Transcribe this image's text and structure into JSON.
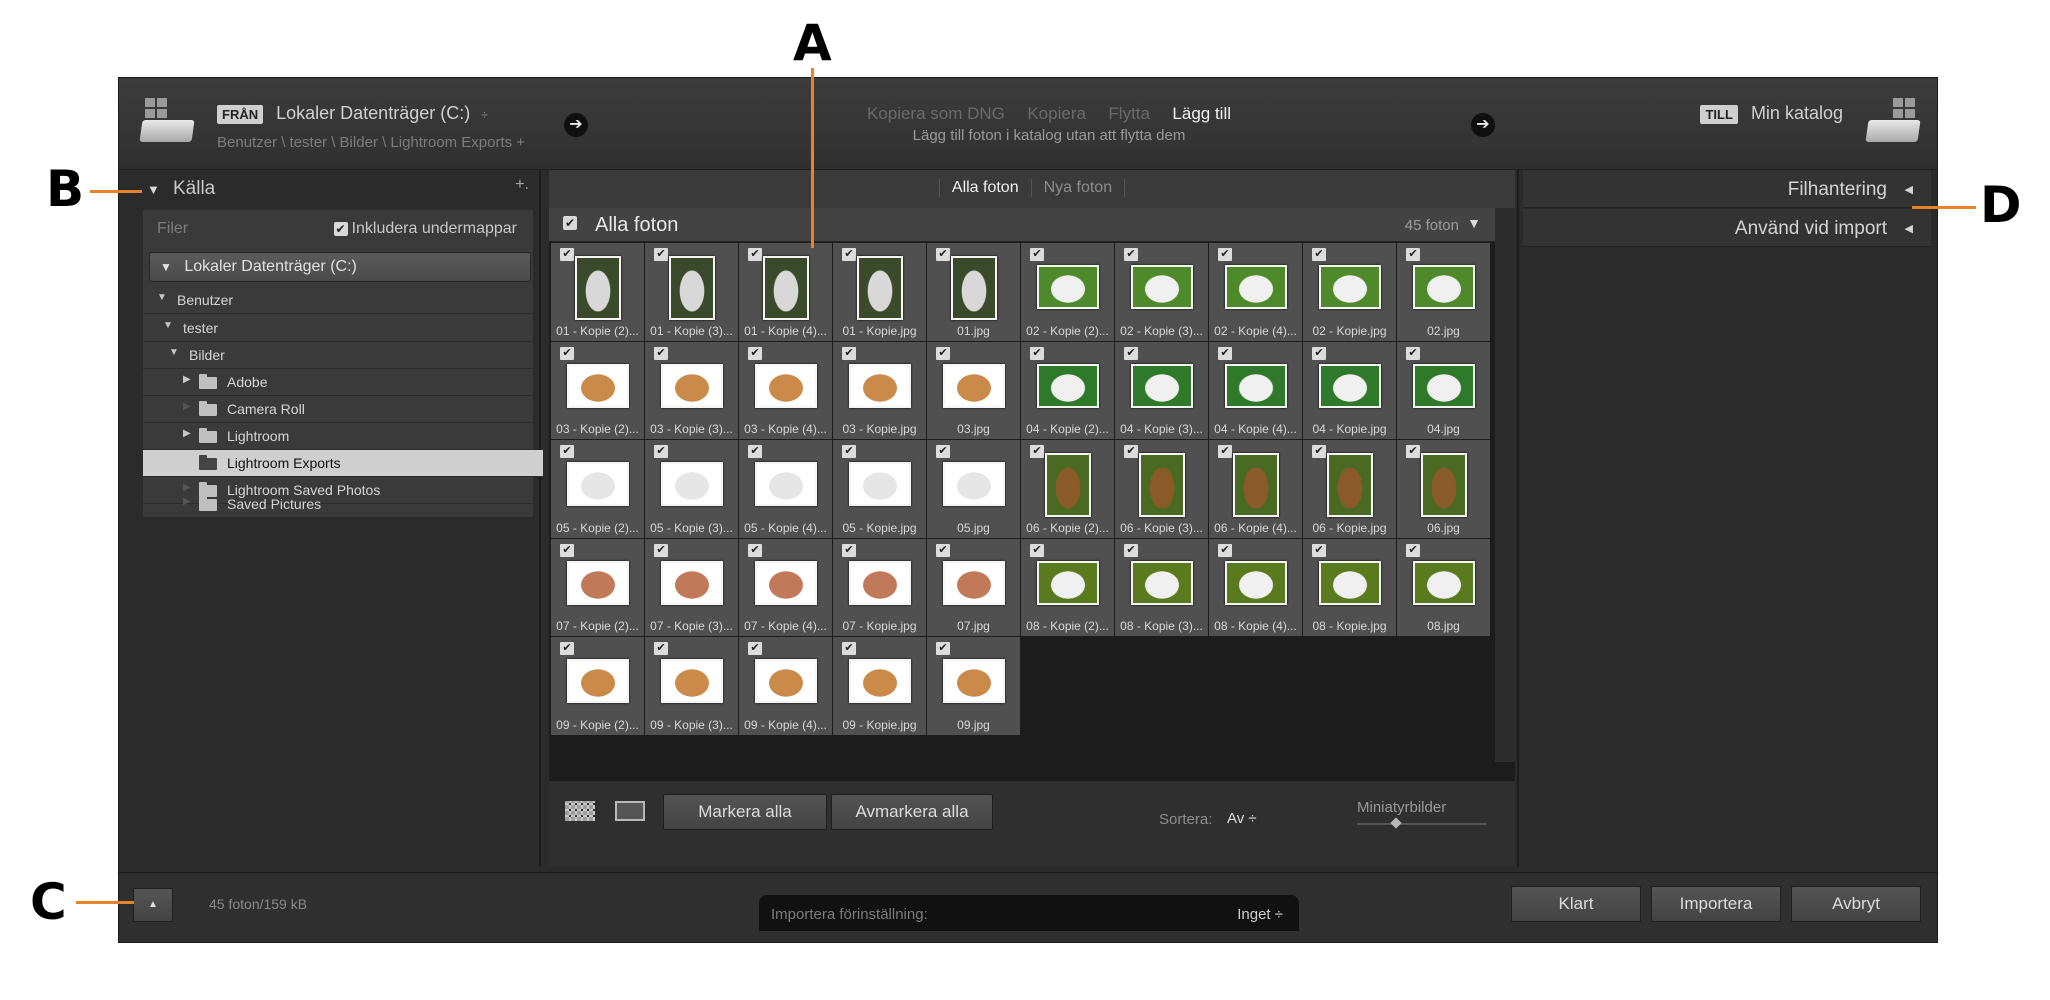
{
  "header": {
    "source_badge": "FRÅN",
    "source_title": "Lokaler Datenträger (C:)",
    "source_sort_glyph": "÷",
    "source_path": "Benutzer \\ tester \\ Bilder \\ Lightroom Exports +",
    "modes": [
      {
        "label": "Kopiera som DNG",
        "active": false
      },
      {
        "label": "Kopiera",
        "active": false
      },
      {
        "label": "Flytta",
        "active": false
      },
      {
        "label": "Lägg till",
        "active": true
      }
    ],
    "mode_subtitle": "Lägg till foton i katalog utan att flytta dem",
    "dest_badge": "TILL",
    "dest_title": "Min katalog"
  },
  "left_panel": {
    "title": "Källa",
    "plus": "+.",
    "filer_label": "Filer",
    "include_subfolders": "Inkludera undermappar",
    "volume": "Lokaler Datenträger (C:)",
    "tree": [
      {
        "label": "Benutzer",
        "level": 0,
        "expanded": true
      },
      {
        "label": "tester",
        "level": 1,
        "expanded": true
      },
      {
        "label": "Bilder",
        "level": 2,
        "expanded": true
      },
      {
        "label": "Adobe",
        "level": 3,
        "folder": true,
        "has_children": true
      },
      {
        "label": "Camera Roll",
        "level": 3,
        "folder": true,
        "has_children": false
      },
      {
        "label": "Lightroom",
        "level": 3,
        "folder": true,
        "has_children": true
      },
      {
        "label": "Lightroom Exports",
        "level": 3,
        "folder": true,
        "has_children": false,
        "selected": true
      },
      {
        "label": "Lightroom Saved Photos",
        "level": 3,
        "folder": true,
        "has_children": false
      },
      {
        "label": "Saved Pictures",
        "level": 3,
        "folder": true,
        "has_children": false
      }
    ]
  },
  "center": {
    "tabs": [
      {
        "label": "Alla foton",
        "active": true
      },
      {
        "label": "Nya foton",
        "active": false
      }
    ],
    "grid_title": "Alla foton",
    "grid_count": "45 foton",
    "photos": [
      {
        "caption": "01 - Kopie (2)...",
        "style": "port",
        "colors": [
          "#3b4a2a",
          "#d8d8d8"
        ]
      },
      {
        "caption": "01 - Kopie (3)...",
        "style": "port",
        "colors": [
          "#3b4a2a",
          "#d8d8d8"
        ]
      },
      {
        "caption": "01 - Kopie (4)...",
        "style": "port",
        "colors": [
          "#3b4a2a",
          "#d8d8d8"
        ]
      },
      {
        "caption": "01 - Kopie.jpg",
        "style": "port",
        "colors": [
          "#3b4a2a",
          "#d8d8d8"
        ]
      },
      {
        "caption": "01.jpg",
        "style": "port",
        "colors": [
          "#3b4a2a",
          "#d8d8d8"
        ]
      },
      {
        "caption": "02 - Kopie (2)...",
        "style": "land",
        "colors": [
          "#4f8a2a",
          "#f0f0f0"
        ]
      },
      {
        "caption": "02 - Kopie (3)...",
        "style": "land",
        "colors": [
          "#4f8a2a",
          "#f0f0f0"
        ]
      },
      {
        "caption": "02 - Kopie (4)...",
        "style": "land",
        "colors": [
          "#4f8a2a",
          "#f0f0f0"
        ]
      },
      {
        "caption": "02 - Kopie.jpg",
        "style": "land",
        "colors": [
          "#4f8a2a",
          "#f0f0f0"
        ]
      },
      {
        "caption": "02.jpg",
        "style": "land",
        "colors": [
          "#4f8a2a",
          "#f0f0f0"
        ]
      },
      {
        "caption": "03 - Kopie (2)...",
        "style": "land",
        "colors": [
          "#ffffff",
          "#c98a4a"
        ]
      },
      {
        "caption": "03 - Kopie (3)...",
        "style": "land",
        "colors": [
          "#ffffff",
          "#c98a4a"
        ]
      },
      {
        "caption": "03 - Kopie (4)...",
        "style": "land",
        "colors": [
          "#ffffff",
          "#c98a4a"
        ]
      },
      {
        "caption": "03 - Kopie.jpg",
        "style": "land",
        "colors": [
          "#ffffff",
          "#c98a4a"
        ]
      },
      {
        "caption": "03.jpg",
        "style": "land",
        "colors": [
          "#ffffff",
          "#c98a4a"
        ]
      },
      {
        "caption": "04 - Kopie (2)...",
        "style": "land",
        "colors": [
          "#2f7a2a",
          "#f0f0f0"
        ]
      },
      {
        "caption": "04 - Kopie (3)...",
        "style": "land",
        "colors": [
          "#2f7a2a",
          "#f0f0f0"
        ]
      },
      {
        "caption": "04 - Kopie (4)...",
        "style": "land",
        "colors": [
          "#2f7a2a",
          "#f0f0f0"
        ]
      },
      {
        "caption": "04 - Kopie.jpg",
        "style": "land",
        "colors": [
          "#2f7a2a",
          "#f0f0f0"
        ]
      },
      {
        "caption": "04.jpg",
        "style": "land",
        "colors": [
          "#2f7a2a",
          "#f0f0f0"
        ]
      },
      {
        "caption": "05 - Kopie (2)...",
        "style": "land",
        "colors": [
          "#ffffff",
          "#e6e6e6"
        ]
      },
      {
        "caption": "05 - Kopie (3)...",
        "style": "land",
        "colors": [
          "#ffffff",
          "#e6e6e6"
        ]
      },
      {
        "caption": "05 - Kopie (4)...",
        "style": "land",
        "colors": [
          "#ffffff",
          "#e6e6e6"
        ]
      },
      {
        "caption": "05 - Kopie.jpg",
        "style": "land",
        "colors": [
          "#ffffff",
          "#e6e6e6"
        ]
      },
      {
        "caption": "05.jpg",
        "style": "land",
        "colors": [
          "#ffffff",
          "#e6e6e6"
        ]
      },
      {
        "caption": "06 - Kopie (2)...",
        "style": "port",
        "colors": [
          "#4a6a24",
          "#8a5a2a"
        ]
      },
      {
        "caption": "06 - Kopie (3)...",
        "style": "port",
        "colors": [
          "#4a6a24",
          "#8a5a2a"
        ]
      },
      {
        "caption": "06 - Kopie (4)...",
        "style": "port",
        "colors": [
          "#4a6a24",
          "#8a5a2a"
        ]
      },
      {
        "caption": "06 - Kopie.jpg",
        "style": "port",
        "colors": [
          "#4a6a24",
          "#8a5a2a"
        ]
      },
      {
        "caption": "06.jpg",
        "style": "port",
        "colors": [
          "#4a6a24",
          "#8a5a2a"
        ]
      },
      {
        "caption": "07 - Kopie (2)...",
        "style": "land",
        "colors": [
          "#ffffff",
          "#c07a5a"
        ]
      },
      {
        "caption": "07 - Kopie (3)...",
        "style": "land",
        "colors": [
          "#ffffff",
          "#c07a5a"
        ]
      },
      {
        "caption": "07 - Kopie (4)...",
        "style": "land",
        "colors": [
          "#ffffff",
          "#c07a5a"
        ]
      },
      {
        "caption": "07 - Kopie.jpg",
        "style": "land",
        "colors": [
          "#ffffff",
          "#c07a5a"
        ]
      },
      {
        "caption": "07.jpg",
        "style": "land",
        "colors": [
          "#ffffff",
          "#c07a5a"
        ]
      },
      {
        "caption": "08 - Kopie (2)...",
        "style": "land",
        "colors": [
          "#5a7a1e",
          "#f0f0f0"
        ]
      },
      {
        "caption": "08 - Kopie (3)...",
        "style": "land",
        "colors": [
          "#5a7a1e",
          "#f0f0f0"
        ]
      },
      {
        "caption": "08 - Kopie (4)...",
        "style": "land",
        "colors": [
          "#5a7a1e",
          "#f0f0f0"
        ]
      },
      {
        "caption": "08 - Kopie.jpg",
        "style": "land",
        "colors": [
          "#5a7a1e",
          "#f0f0f0"
        ]
      },
      {
        "caption": "08.jpg",
        "style": "land",
        "colors": [
          "#5a7a1e",
          "#f0f0f0"
        ]
      },
      {
        "caption": "09 - Kopie (2)...",
        "style": "land",
        "colors": [
          "#ffffff",
          "#c98a4a"
        ]
      },
      {
        "caption": "09 - Kopie (3)...",
        "style": "land",
        "colors": [
          "#ffffff",
          "#c98a4a"
        ]
      },
      {
        "caption": "09 - Kopie (4)...",
        "style": "land",
        "colors": [
          "#ffffff",
          "#c98a4a"
        ]
      },
      {
        "caption": "09 - Kopie.jpg",
        "style": "land",
        "colors": [
          "#ffffff",
          "#c98a4a"
        ]
      },
      {
        "caption": "09.jpg",
        "style": "land",
        "colors": [
          "#ffffff",
          "#c98a4a"
        ]
      }
    ],
    "select_all": "Markera alla",
    "deselect_all": "Avmarkera alla",
    "sort_label": "Sortera:",
    "sort_value": "Av ÷",
    "thumbs_label": "Miniatyrbilder",
    "thumb_size_fraction": 0.3
  },
  "right_panel": {
    "sections": [
      {
        "label": "Filhantering"
      },
      {
        "label": "Använd vid import"
      }
    ]
  },
  "status": {
    "count": "45 foton/159 kB",
    "preset_label": "Importera förinställning:",
    "preset_value": "Inget ÷",
    "done": "Klart",
    "import": "Importera",
    "cancel": "Avbryt"
  },
  "callouts": {
    "a": "A",
    "b": "B",
    "c": "C",
    "d": "D"
  },
  "colors": {
    "accent_line": "#e8832a",
    "panel_bg": "#2b2b2b"
  }
}
